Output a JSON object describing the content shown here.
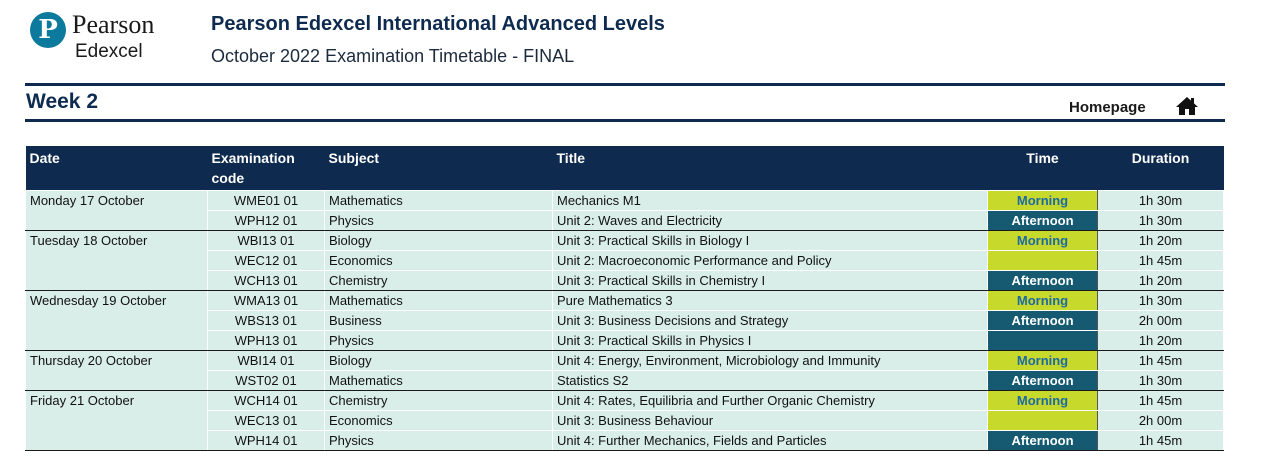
{
  "header": {
    "logo_letter": "P",
    "logo_word1": "Pearson",
    "logo_word2": "Edexcel",
    "title": "Pearson Edexcel International Advanced Levels",
    "subtitle": "October 2022 Examination Timetable - FINAL"
  },
  "week_label": "Week 2",
  "homepage_label": "Homepage",
  "colors": {
    "navy": "#0e2b4f",
    "morning": "#c7d92a",
    "afternoon": "#155a71",
    "row": "#d9eee9"
  },
  "table": {
    "headers": {
      "date": "Date",
      "code": "Examination code",
      "subject": "Subject",
      "title": "Title",
      "time": "Time",
      "duration": "Duration"
    },
    "rows": [
      {
        "date": "Monday 17 October",
        "code": "WME01 01",
        "subject": "Mathematics",
        "title": "Mechanics M1",
        "time": "Morning",
        "duration": "1h 30m"
      },
      {
        "date": "",
        "code": "WPH12 01",
        "subject": "Physics",
        "title": "Unit 2: Waves and Electricity",
        "time": "Afternoon",
        "duration": "1h 30m"
      },
      {
        "date": "Tuesday 18 October",
        "code": "WBI13 01",
        "subject": "Biology",
        "title": "Unit 3: Practical Skills in Biology I",
        "time": "Morning",
        "duration": "1h 20m"
      },
      {
        "date": "",
        "code": "WEC12 01",
        "subject": "Economics",
        "title": "Unit 2: Macroeconomic Performance and Policy",
        "time": "",
        "duration": "1h 45m"
      },
      {
        "date": "",
        "code": "WCH13 01",
        "subject": "Chemistry",
        "title": "Unit 3: Practical Skills in Chemistry I",
        "time": "Afternoon",
        "duration": "1h 20m"
      },
      {
        "date": "Wednesday 19 October",
        "code": "WMA13 01",
        "subject": "Mathematics",
        "title": "Pure Mathematics 3",
        "time": "Morning",
        "duration": "1h 30m"
      },
      {
        "date": "",
        "code": "WBS13 01",
        "subject": "Business",
        "title": "Unit 3: Business Decisions and Strategy",
        "time": "Afternoon",
        "duration": "2h 00m"
      },
      {
        "date": "",
        "code": "WPH13 01",
        "subject": "Physics",
        "title": "Unit 3: Practical Skills in Physics I",
        "time": "",
        "duration": "1h 20m"
      },
      {
        "date": "Thursday 20 October",
        "code": "WBI14 01",
        "subject": "Biology",
        "title": "Unit 4: Energy, Environment, Microbiology and Immunity",
        "time": "Morning",
        "duration": "1h 45m"
      },
      {
        "date": "",
        "code": "WST02 01",
        "subject": "Mathematics",
        "title": "Statistics S2",
        "time": "Afternoon",
        "duration": "1h 30m"
      },
      {
        "date": "Friday 21 October",
        "code": "WCH14 01",
        "subject": "Chemistry",
        "title": "Unit 4: Rates, Equilibria and Further Organic Chemistry",
        "time": "Morning",
        "duration": "1h 45m"
      },
      {
        "date": "",
        "code": "WEC13 01",
        "subject": "Economics",
        "title": "Unit 3: Business Behaviour",
        "time": "",
        "duration": "2h 00m"
      },
      {
        "date": "",
        "code": "WPH14 01",
        "subject": "Physics",
        "title": "Unit 4: Further Mechanics, Fields and Particles",
        "time": "Afternoon",
        "duration": "1h 45m"
      }
    ]
  }
}
